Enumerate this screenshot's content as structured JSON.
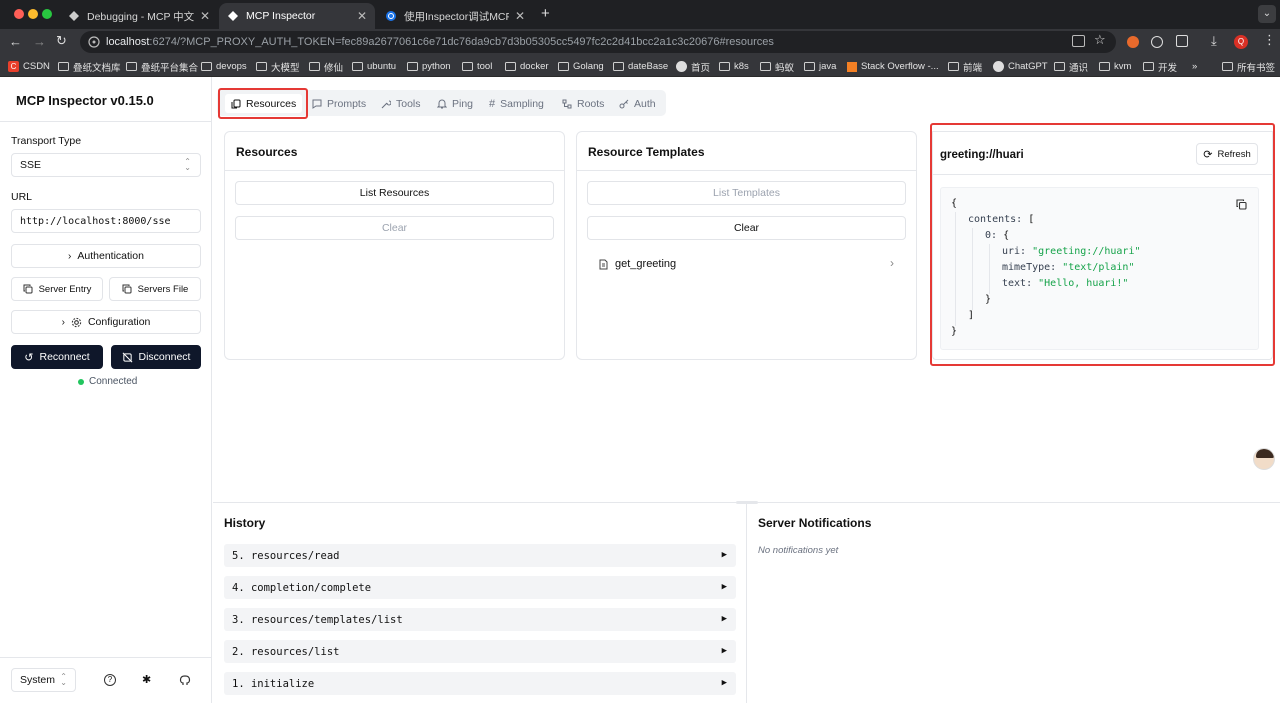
{
  "browser": {
    "tabs": [
      {
        "title": "Debugging - MCP 中文文档"
      },
      {
        "title": "MCP Inspector"
      },
      {
        "title": "使用Inspector调试MCP服务 - "
      }
    ],
    "new_tab": "+",
    "url_host": "localhost",
    "url_rest": ":6274/?MCP_PROXY_AUTH_TOKEN=fec89a2677061c6e71dc76da9cb7d3b05305cc5497fc2c2d41bcc2a1c3c20676#resources",
    "bookmarks": [
      "CSDN",
      "叠纸文档库",
      "叠纸平台集合",
      "devops",
      "大模型",
      "修仙",
      "ubuntu",
      "python",
      "tool",
      "docker",
      "Golang",
      "dateBase",
      "首页",
      "k8s",
      "蚂蚁",
      "java",
      "Stack Overflow -...",
      "前端",
      "ChatGPT",
      "通识",
      "kvm",
      "开发"
    ],
    "bookmarks_overflow": "»",
    "all_bookmarks": "所有书签"
  },
  "sidebar": {
    "title": "MCP Inspector v0.15.0",
    "transport_label": "Transport Type",
    "transport_value": "SSE",
    "url_label": "URL",
    "url_value": "http://localhost:8000/sse",
    "authentication": "Authentication",
    "server_entry": "Server Entry",
    "servers_file": "Servers File",
    "configuration": "Configuration",
    "reconnect": "Reconnect",
    "disconnect": "Disconnect",
    "status": "Connected",
    "status_color": "#22c55e",
    "theme": "System"
  },
  "tabs": [
    "Resources",
    "Prompts",
    "Tools",
    "Ping",
    "Sampling",
    "Roots",
    "Auth"
  ],
  "resources": {
    "title": "Resources",
    "list_button": "List Resources",
    "clear_button": "Clear"
  },
  "templates": {
    "title": "Resource Templates",
    "list_button": "List Templates",
    "clear_button": "Clear",
    "items": [
      "get_greeting"
    ]
  },
  "detail": {
    "title": "greeting://huari",
    "refresh": "Refresh",
    "json": {
      "open": "{",
      "contents_key": "contents:",
      "arr_open": "[",
      "idx_key": "0:",
      "obj_open": "{",
      "uri_key": "uri:",
      "uri_val": "\"greeting://huari\"",
      "mime_key": "mimeType:",
      "mime_val": "\"text/plain\"",
      "text_key": "text:",
      "text_val": "\"Hello, huari!\"",
      "obj_close": "}",
      "arr_close": "]",
      "close": "}"
    }
  },
  "history": {
    "title": "History",
    "items": [
      "5. resources/read",
      "4. completion/complete",
      "3. resources/templates/list",
      "2. resources/list",
      "1. initialize"
    ]
  },
  "notifications": {
    "title": "Server Notifications",
    "empty": "No notifications yet"
  },
  "colors": {
    "highlight": "#e53935",
    "json_string": "#16a34a",
    "primary_dark": "#0f172a"
  }
}
